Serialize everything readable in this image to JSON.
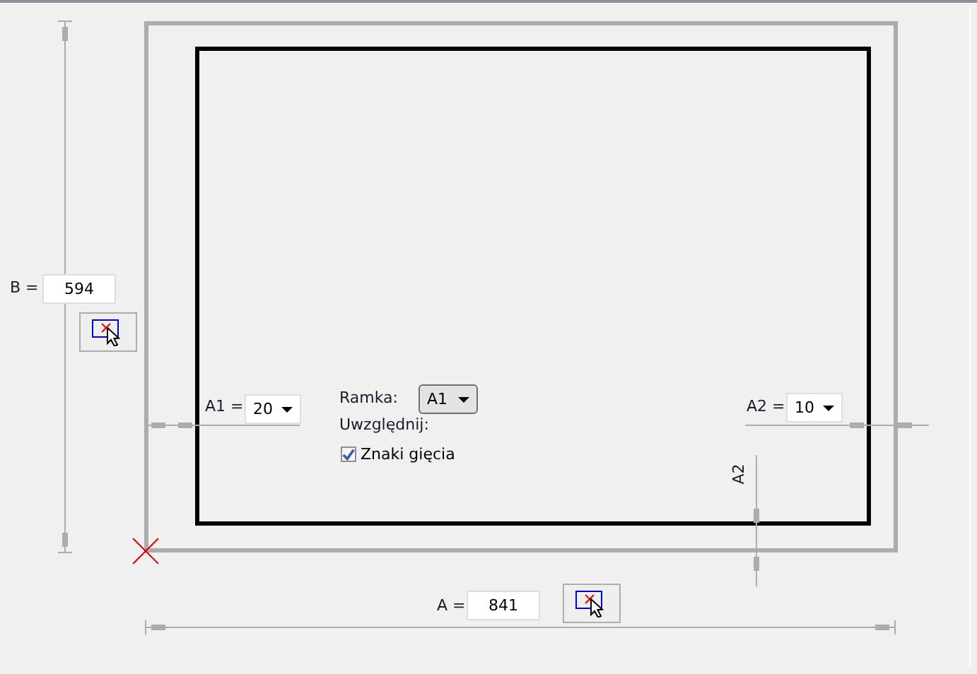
{
  "dimension_b": {
    "label": "B =",
    "value": "594"
  },
  "dimension_a": {
    "label": "A =",
    "value": "841"
  },
  "margin_a1": {
    "label": "A1 =",
    "value": "20"
  },
  "margin_a2": {
    "label": "A2 =",
    "value": "10"
  },
  "frame": {
    "label": "Ramka:",
    "value": "A1"
  },
  "include": {
    "label": "Uwzględnij:"
  },
  "fold_marks": {
    "label": "Znaki gięcia",
    "checked": true
  },
  "a2_axis_label": "A2"
}
